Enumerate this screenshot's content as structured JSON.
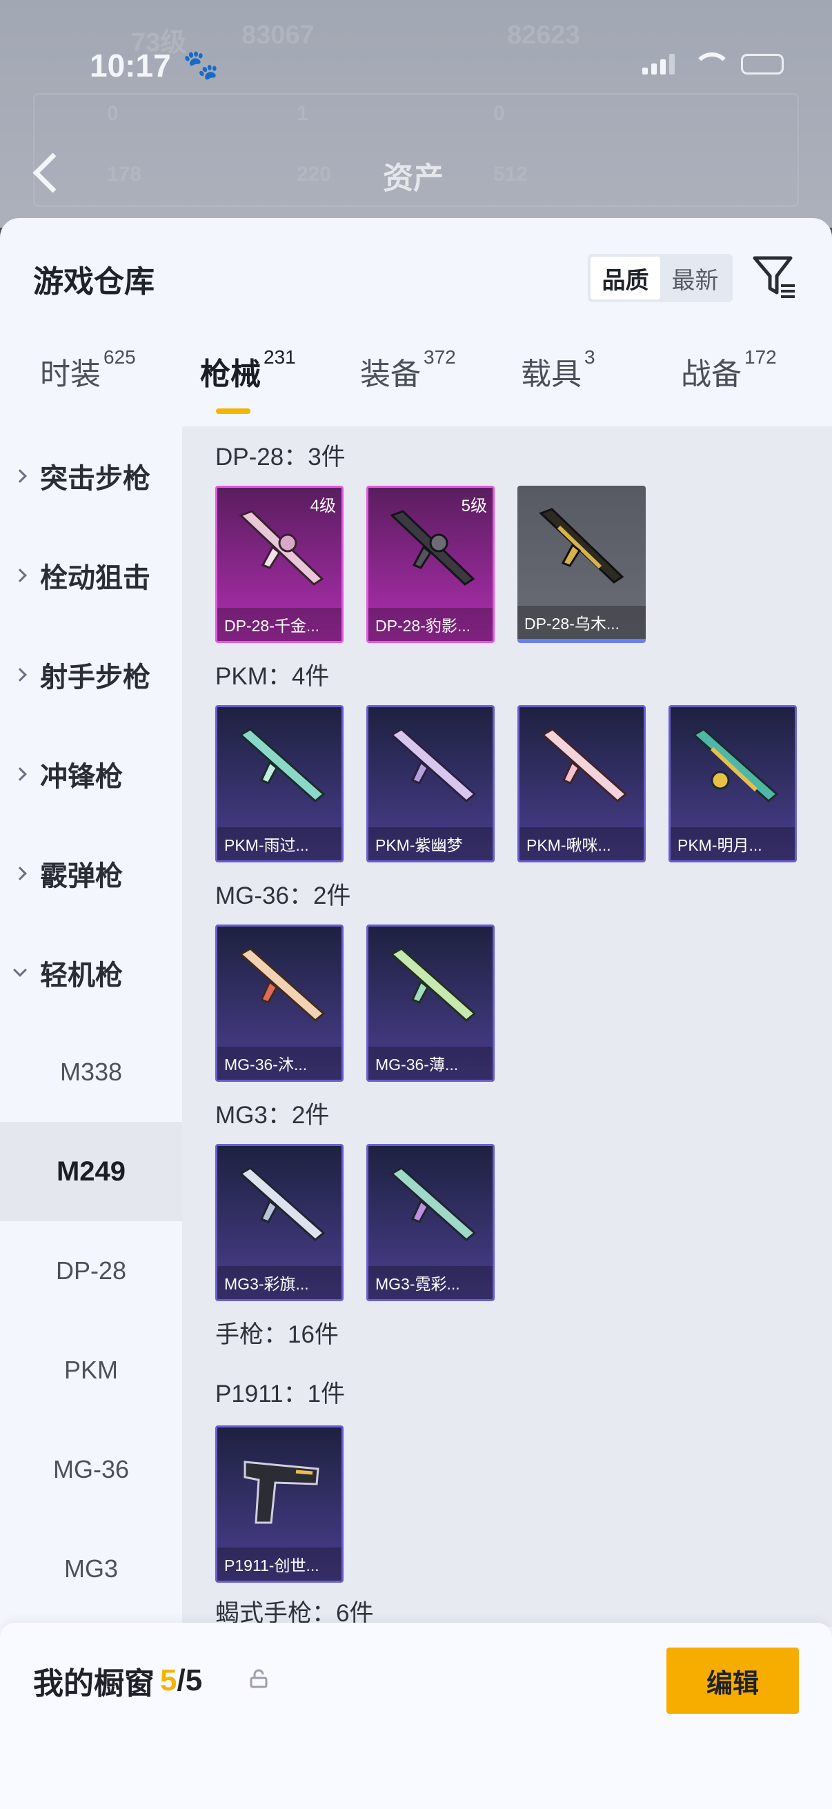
{
  "status_bar": {
    "time": "10:17"
  },
  "background": {
    "header_title": "资产",
    "faded": [
      "73级",
      "83067",
      "82623",
      "0",
      "1",
      "0",
      "178",
      "220",
      "512"
    ]
  },
  "sheet": {
    "title": "游戏仓库",
    "sort": {
      "options": [
        "品质",
        "最新"
      ],
      "active": "品质"
    }
  },
  "tabs": [
    {
      "label": "时装",
      "count": "625"
    },
    {
      "label": "枪械",
      "count": "231",
      "active": true
    },
    {
      "label": "装备",
      "count": "372"
    },
    {
      "label": "载具",
      "count": "3"
    },
    {
      "label": "战备",
      "count": "172"
    }
  ],
  "sidebar": {
    "categories": [
      "突击步枪",
      "栓动狙击",
      "射手步枪",
      "冲锋枪",
      "霰弹枪",
      "轻机枪"
    ],
    "subcategories": [
      "M338",
      "M249",
      "DP-28",
      "PKM",
      "MG-36",
      "MG3"
    ],
    "selected": "M249"
  },
  "groups": [
    {
      "title": "DP-28：3件",
      "items": [
        {
          "name": "DP-28-千金...",
          "level": "4级",
          "rarity": "purple"
        },
        {
          "name": "DP-28-豹影...",
          "level": "5级",
          "rarity": "purple"
        },
        {
          "name": "DP-28-乌木...",
          "level": "",
          "rarity": "gray"
        }
      ]
    },
    {
      "title": "PKM：4件",
      "items": [
        {
          "name": "PKM-雨过...",
          "rarity": "blue"
        },
        {
          "name": "PKM-紫幽梦",
          "rarity": "blue"
        },
        {
          "name": "PKM-啾咪...",
          "rarity": "blue"
        },
        {
          "name": "PKM-明月...",
          "rarity": "blue"
        }
      ]
    },
    {
      "title": "MG-36：2件",
      "items": [
        {
          "name": "MG-36-沐...",
          "rarity": "blue"
        },
        {
          "name": "MG-36-薄...",
          "rarity": "blue"
        }
      ]
    },
    {
      "title": "MG3：2件",
      "items": [
        {
          "name": "MG3-彩旗...",
          "rarity": "blue"
        },
        {
          "name": "MG3-霓彩...",
          "rarity": "blue"
        }
      ]
    },
    {
      "title": "手枪：16件"
    },
    {
      "title": "P1911：1件",
      "items": [
        {
          "name": "P1911-创世...",
          "rarity": "blue"
        }
      ]
    },
    {
      "title": "蝎式手枪：6件"
    }
  ],
  "showcase": {
    "title": "我的橱窗",
    "used": "5",
    "separator": "/",
    "total": "5",
    "edit_label": "编辑"
  },
  "colors": {
    "accent": "#f5b400",
    "purple_rarity": "#b12fb1",
    "blue_rarity": "#4b3f8f"
  }
}
